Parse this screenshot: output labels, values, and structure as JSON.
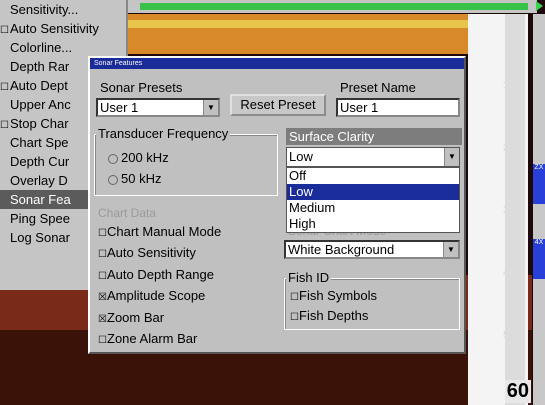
{
  "colors": {
    "dialog_title_bg": "#1a2b9a",
    "menu_selected_bg": "#5b5b5b",
    "accent_green": "#39c24a",
    "scale_tab": "#2840d8"
  },
  "side_menu": {
    "items": [
      {
        "label": "Sensitivity...",
        "check": ""
      },
      {
        "label": "Auto Sensitivity",
        "check": "☐"
      },
      {
        "label": "Colorline...",
        "check": ""
      },
      {
        "label": "Depth Rar",
        "check": ""
      },
      {
        "label": "Auto Dept",
        "check": "☐"
      },
      {
        "label": "Upper Anc",
        "check": ""
      },
      {
        "label": "Stop Char",
        "check": "☐"
      },
      {
        "label": "Chart Spe",
        "check": ""
      },
      {
        "label": "Depth Cur",
        "check": ""
      },
      {
        "label": "Overlay D",
        "check": ""
      },
      {
        "label": "Sonar Fea",
        "check": "",
        "selected": true
      },
      {
        "label": "Ping Spee",
        "check": ""
      },
      {
        "label": "Log Sonar",
        "check": ""
      }
    ]
  },
  "depth_scale": {
    "labels": [
      "10",
      "20",
      "30",
      "40",
      "50"
    ],
    "max": "60",
    "tab_top": "ZX",
    "tab_mid": "4X"
  },
  "dialog": {
    "title": "Sonar Features",
    "presets_label": "Sonar Presets",
    "presets_value": "User 1",
    "reset_button": "Reset Preset",
    "preset_name_label": "Preset Name",
    "preset_name_value": "User 1",
    "transducer": {
      "title": "Transducer Frequency",
      "options": [
        "200 kHz",
        "50 kHz"
      ]
    },
    "chart_data_label": "Chart Data",
    "checks": [
      {
        "label": "Chart Manual Mode",
        "mark": "☐"
      },
      {
        "label": "Auto Sensitivity",
        "mark": "☐"
      },
      {
        "label": "Auto Depth Range",
        "mark": "☐"
      },
      {
        "label": "Amplitude Scope",
        "mark": "☒"
      },
      {
        "label": "Zoom Bar",
        "mark": "☒"
      },
      {
        "label": "Zone Alarm Bar",
        "mark": "☐"
      }
    ],
    "surface_clarity": {
      "title": "Surface Clarity",
      "value": "Low",
      "options": [
        "Off",
        "Low",
        "Medium",
        "High"
      ],
      "selected_index": 1
    },
    "chart_mode_label": "Sonar Chart Mode",
    "chart_mode_value": "White Background",
    "fish_id": {
      "title": "Fish ID",
      "options": [
        {
          "label": "Fish Symbols",
          "mark": "☐"
        },
        {
          "label": "Fish Depths",
          "mark": "☐"
        }
      ]
    }
  }
}
